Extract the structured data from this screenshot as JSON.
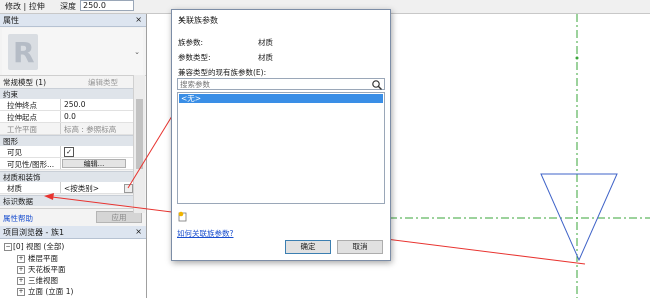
{
  "optbar": {
    "mode": "修改 | 拉伸",
    "depth_label": "深度",
    "depth_value": "250.0"
  },
  "properties": {
    "title": "属性",
    "close": "×",
    "type_selector": "常规模型 (1)",
    "edit_type": "编辑类型",
    "sections": {
      "constraints": "约束",
      "graphics": "图形",
      "materials": "材质和装饰",
      "identity": "标识数据"
    },
    "rows": [
      {
        "key": "拉伸终点",
        "value": "250.0"
      },
      {
        "key": "拉伸起点",
        "value": "0.0"
      },
      {
        "key": "工作平面",
        "value": "标高 : 参照标高"
      },
      {
        "key": "可见",
        "value": ""
      },
      {
        "key": "可见性/图形...",
        "value": "编辑..."
      },
      {
        "key": "材质",
        "value": "<按类别>"
      }
    ],
    "help_link": "属性帮助",
    "apply": "应用"
  },
  "browser": {
    "title": "项目浏览器 - 族1",
    "close": "×",
    "items": [
      {
        "label": "视图 (全部)",
        "prefix": "[0]"
      },
      {
        "label": "楼层平面",
        "prefix": ""
      },
      {
        "label": "天花板平面",
        "prefix": ""
      },
      {
        "label": "三维视图",
        "prefix": ""
      },
      {
        "label": "立面 (立面 1)",
        "prefix": ""
      }
    ]
  },
  "dialog": {
    "title": "关联族参数",
    "close": "✕",
    "family_param_label": "族参数:",
    "family_param_value": "材质",
    "param_type_label": "参数类型:",
    "param_type_value": "材质",
    "compatible_label": "兼容类型的现有族参数(E):",
    "search_placeholder": "搜索参数",
    "list_selected": "<无>",
    "help_link": "如何关联族参数?",
    "ok": "确定",
    "cancel": "取消"
  },
  "icons": {
    "search": "search-icon",
    "add": "add-parameter-icon",
    "logo": "revit-logo-icon"
  },
  "colors": {
    "accent": "#3a8ee6",
    "annotation": "#e8332f",
    "reference": "#3aa63a",
    "triangle": "#3f63c8"
  }
}
